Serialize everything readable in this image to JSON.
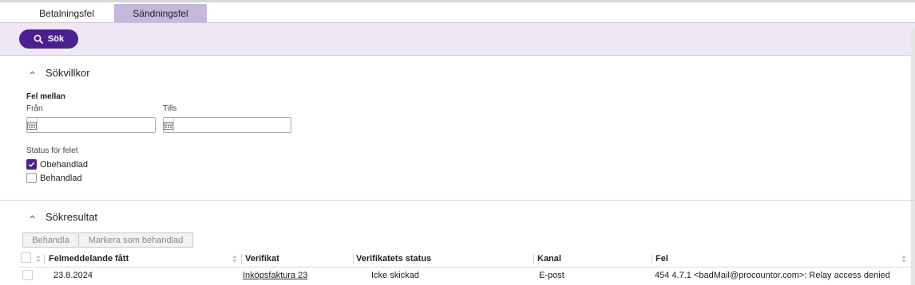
{
  "tabs": [
    {
      "label": "Betalningsfel",
      "active": false
    },
    {
      "label": "Sändningsfel",
      "active": true
    }
  ],
  "toolbar": {
    "search_label": "Sök"
  },
  "criteria": {
    "title": "Sökvillkor",
    "period_label": "Fel mellan",
    "from_label": "Från",
    "to_label": "Tills",
    "from_value": "",
    "to_value": "",
    "status_label": "Status för felet",
    "options": [
      {
        "label": "Obehandlad",
        "checked": true
      },
      {
        "label": "Behandlad",
        "checked": false
      }
    ]
  },
  "results": {
    "title": "Sökresultat",
    "actions": [
      "Behandla",
      "Markera som behandlad"
    ],
    "columns": [
      "Felmeddelande fått",
      "Verifikat",
      "Verifikatets status",
      "Kanal",
      "Fel"
    ],
    "rows": [
      {
        "received": "23.8.2024",
        "document": "Inköpsfaktura 23",
        "document_status": "Icke skickad",
        "channel": "E-post",
        "error": "454 4.7.1 <badMail@procountor.com>: Relay access denied"
      }
    ]
  },
  "colors": {
    "accent": "#4b1f8f",
    "active_tab": "#c8b7dc",
    "toolbar_bg": "#eee8f5"
  }
}
